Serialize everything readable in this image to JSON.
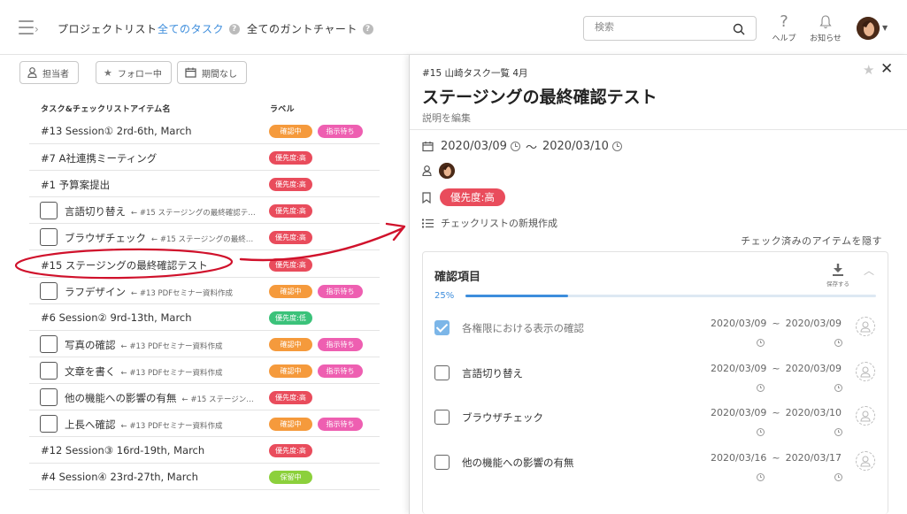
{
  "header": {
    "nav": [
      {
        "label": "プロジェクトリスト",
        "active": false
      },
      {
        "label": "全てのタスク",
        "active": true
      },
      {
        "label": "全てのガントチャート",
        "active": false
      }
    ],
    "help_glyph": "?",
    "search": {
      "placeholder": "検索"
    },
    "help_label": "ヘルプ",
    "notify_label": "お知らせ"
  },
  "filters": [
    {
      "label": "担当者",
      "icon": "user-icon"
    },
    {
      "label": "フォロー中",
      "icon": "star-icon"
    },
    {
      "label": "期間なし",
      "icon": "calendar-icon"
    }
  ],
  "list": {
    "col_task": "タスク&チェックリストアイテム名",
    "col_label": "ラベル",
    "rows": [
      {
        "title": "#13 Session① 2rd-6th, March",
        "sub": "",
        "checkbox": false,
        "labels": [
          {
            "text": "確認中",
            "color": "orange"
          },
          {
            "text": "指示待ち",
            "color": "pink"
          }
        ]
      },
      {
        "title": "#7 A社連携ミーティング",
        "sub": "",
        "checkbox": false,
        "labels": [
          {
            "text": "優先度:高",
            "color": "red"
          }
        ]
      },
      {
        "title": "#1 予算案提出",
        "sub": "",
        "checkbox": false,
        "labels": [
          {
            "text": "優先度:高",
            "color": "red"
          }
        ]
      },
      {
        "title": "言語切り替え",
        "sub": "← #15 ステージングの最終確認テ…",
        "checkbox": true,
        "labels": [
          {
            "text": "優先度:高",
            "color": "red"
          }
        ]
      },
      {
        "title": "ブラウザチェック",
        "sub": "← #15 ステージングの最終…",
        "checkbox": true,
        "labels": [
          {
            "text": "優先度:高",
            "color": "red"
          }
        ]
      },
      {
        "title": "#15 ステージングの最終確認テスト",
        "sub": "",
        "checkbox": false,
        "labels": [
          {
            "text": "優先度:高",
            "color": "red"
          }
        ]
      },
      {
        "title": "ラフデザイン",
        "sub": "← #13 PDFセミナー資料作成",
        "checkbox": true,
        "labels": [
          {
            "text": "確認中",
            "color": "orange"
          },
          {
            "text": "指示待ち",
            "color": "pink"
          }
        ]
      },
      {
        "title": "#6 Session② 9rd-13th, March",
        "sub": "",
        "checkbox": false,
        "labels": [
          {
            "text": "優先度:低",
            "color": "green"
          }
        ]
      },
      {
        "title": "写真の確認",
        "sub": "← #13 PDFセミナー資料作成",
        "checkbox": true,
        "labels": [
          {
            "text": "確認中",
            "color": "orange"
          },
          {
            "text": "指示待ち",
            "color": "pink"
          }
        ]
      },
      {
        "title": "文章を書く",
        "sub": "← #13 PDFセミナー資料作成",
        "checkbox": true,
        "labels": [
          {
            "text": "確認中",
            "color": "orange"
          },
          {
            "text": "指示待ち",
            "color": "pink"
          }
        ]
      },
      {
        "title": "他の機能への影響の有無",
        "sub": "← #15 ステージン…",
        "checkbox": true,
        "labels": [
          {
            "text": "優先度:高",
            "color": "red"
          }
        ]
      },
      {
        "title": "上長へ確認",
        "sub": "← #13 PDFセミナー資料作成",
        "checkbox": true,
        "labels": [
          {
            "text": "確認中",
            "color": "orange"
          },
          {
            "text": "指示待ち",
            "color": "pink"
          }
        ]
      },
      {
        "title": "#12 Session③ 16rd-19th, March",
        "sub": "",
        "checkbox": false,
        "labels": [
          {
            "text": "優先度:高",
            "color": "red"
          }
        ]
      },
      {
        "title": "#4 Session④ 23rd-27th, March",
        "sub": "",
        "checkbox": false,
        "labels": [
          {
            "text": "保留中",
            "color": "lime"
          }
        ]
      }
    ]
  },
  "panel": {
    "breadcrumb": "#15 山崎タスク一覧 4月",
    "title": "ステージングの最終確認テスト",
    "edit_desc": "説明を編集",
    "start_date": "2020/03/09",
    "tilde": "〜",
    "end_date": "2020/03/10",
    "priority": "優先度:高",
    "new_checklist": "チェックリストの新規作成",
    "hide_checked": "チェック済みのアイテムを隠す",
    "checklist": {
      "title": "確認項目",
      "save_label": "保存する",
      "progress_text": "25%",
      "progress": 0.25,
      "range_sep": "~",
      "items": [
        {
          "name": "各権限における表示の確認",
          "checked": true,
          "start": "2020/03/09",
          "end": "2020/03/09"
        },
        {
          "name": "言語切り替え",
          "checked": false,
          "start": "2020/03/09",
          "end": "2020/03/09"
        },
        {
          "name": "ブラウザチェック",
          "checked": false,
          "start": "2020/03/09",
          "end": "2020/03/10"
        },
        {
          "name": "他の機能への影響の有無",
          "checked": false,
          "start": "2020/03/16",
          "end": "2020/03/17"
        }
      ]
    }
  },
  "colors": {
    "accent": "#3d8ddc",
    "orange": "#f59a3c",
    "pink": "#ee5fb1",
    "red": "#e94c5c",
    "green": "#3bc27a",
    "lime": "#8cd03c",
    "annotation": "#d0112b"
  }
}
